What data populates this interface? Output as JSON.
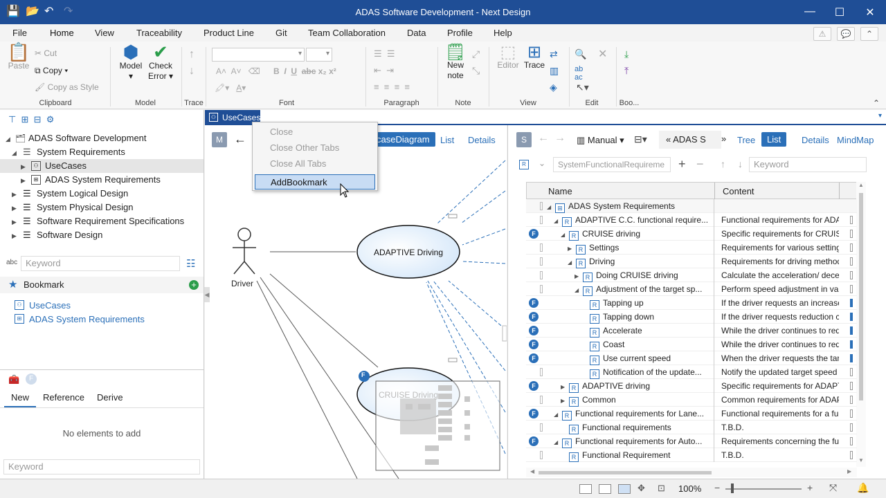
{
  "window": {
    "title": "ADAS Software Development - Next Design"
  },
  "menu": [
    "File",
    "Home",
    "View",
    "Traceability",
    "Product Line",
    "Git",
    "Team Collaboration",
    "Data",
    "Profile",
    "Help"
  ],
  "ribbon": {
    "clipboard": {
      "label": "Clipboard",
      "paste": "Paste",
      "cut": "Cut",
      "copy": "Copy",
      "copy_style": "Copy as Style"
    },
    "model": {
      "label": "Model",
      "model": "Model",
      "check_error_1": "Check",
      "check_error_2": "Error"
    },
    "trace": {
      "label": "Trace"
    },
    "font": {
      "label": "Font"
    },
    "paragraph": {
      "label": "Paragraph"
    },
    "note": {
      "label": "Note",
      "new_note_1": "New",
      "new_note_2": "note"
    },
    "view": {
      "label": "View",
      "editor": "Editor",
      "trace": "Trace"
    },
    "edit": {
      "label": "Edit"
    },
    "bookmark": {
      "label": "Boo..."
    }
  },
  "tree": {
    "items": [
      {
        "label": "ADAS Software Development"
      },
      {
        "label": "System Requirements"
      },
      {
        "label": "UseCases"
      },
      {
        "label": "ADAS System Requirements"
      },
      {
        "label": "System Logical Design"
      },
      {
        "label": "System Physical Design"
      },
      {
        "label": "Software Requirement Specifications"
      },
      {
        "label": "Software Design"
      }
    ],
    "search_placeholder": "Keyword"
  },
  "bookmark": {
    "title": "Bookmark",
    "items": [
      "UseCases",
      "ADAS System Requirements"
    ]
  },
  "bottom_panel": {
    "tabs": [
      "New",
      "Reference",
      "Derive"
    ],
    "empty_text": "No elements to add",
    "search_placeholder": "Keyword"
  },
  "editor_tab": {
    "label": "UseCases"
  },
  "diagram": {
    "view_tabs": [
      "caseDiagram",
      "List",
      "Details"
    ],
    "actor": "Driver",
    "usecase_main": "ADAPTIVE Driving",
    "usecase_second": "CRUISE Driving"
  },
  "context_menu": {
    "items": [
      "Close",
      "Close Other Tabs",
      "Close All Tabs",
      "AddBookmark"
    ]
  },
  "right_pane": {
    "mode": "Manual",
    "breadcrumb": "ADAS S",
    "view_tabs": [
      "Tree",
      "List",
      "Details",
      "MindMap"
    ],
    "filter_placeholder": "SystemFunctionalRequireme",
    "search_placeholder": "Keyword",
    "columns": [
      "Name",
      "Content"
    ],
    "rows": [
      {
        "name": "ADAS System Requirements",
        "content": ""
      },
      {
        "name": "ADAPTIVE C.C. functional require...",
        "content": "Functional requirements for ADA"
      },
      {
        "name": "CRUISE driving",
        "content": "Specific requirements for CRUISE"
      },
      {
        "name": "Settings",
        "content": "Requirements for various setting"
      },
      {
        "name": "Driving",
        "content": "Requirements for driving method"
      },
      {
        "name": "Doing CRUISE driving",
        "content": "Calculate the acceleration/ decel"
      },
      {
        "name": "Adjustment of the target sp...",
        "content": "Perform speed adjustment in var"
      },
      {
        "name": "Tapping up",
        "content": "If the driver requests an increase"
      },
      {
        "name": "Tapping down",
        "content": "If the driver requests reduction c"
      },
      {
        "name": "Accelerate",
        "content": "While the driver continues to req"
      },
      {
        "name": "Coast",
        "content": "While the driver continues to req"
      },
      {
        "name": "Use current speed",
        "content": "When the driver requests the tar"
      },
      {
        "name": "Notification of the update...",
        "content": "Notify the updated target speed"
      },
      {
        "name": "ADAPTIVE driving",
        "content": "Specific requirements for ADAPT"
      },
      {
        "name": "Common",
        "content": "Common requirements for ADAP"
      },
      {
        "name": "Functional requirements for Lane...",
        "content": "Functional requirements for a fu"
      },
      {
        "name": "Functional requirements",
        "content": "T.B.D."
      },
      {
        "name": "Functional requirements for Auto...",
        "content": "Requirements concerning the fur"
      },
      {
        "name": "Functional Requirement",
        "content": "T.B.D."
      }
    ]
  },
  "status": {
    "zoom": "100%"
  }
}
